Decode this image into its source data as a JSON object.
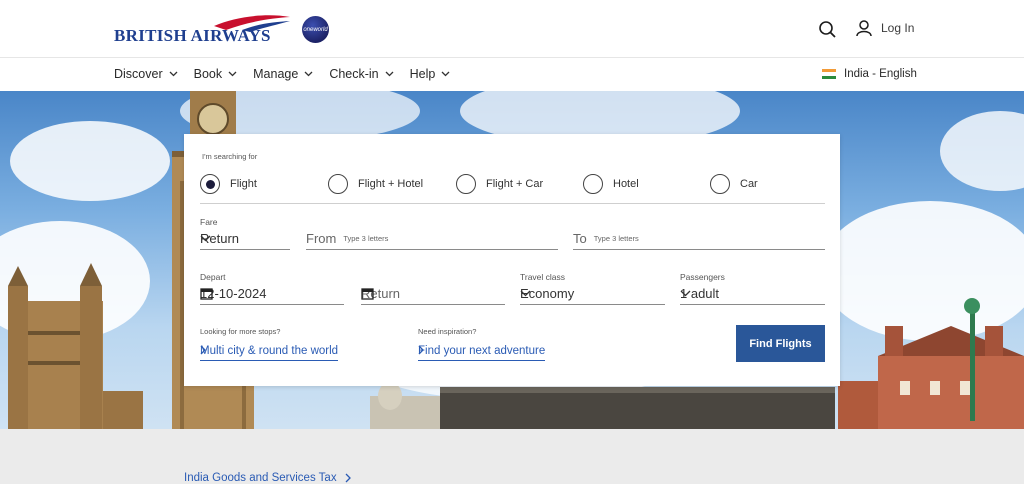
{
  "header": {
    "brand": "BRITISH AIRWAYS",
    "alliance": "oneworld",
    "login_label": "Log In"
  },
  "nav": {
    "items": [
      {
        "label": "Discover"
      },
      {
        "label": "Book"
      },
      {
        "label": "Manage"
      },
      {
        "label": "Check-in"
      },
      {
        "label": "Help"
      }
    ],
    "locale": "India - English"
  },
  "booking": {
    "searching_label": "I'm searching for",
    "options": [
      {
        "label": "Flight",
        "selected": true
      },
      {
        "label": "Flight + Hotel",
        "selected": false
      },
      {
        "label": "Flight + Car",
        "selected": false
      },
      {
        "label": "Hotel",
        "selected": false
      },
      {
        "label": "Car",
        "selected": false
      }
    ],
    "fare_label": "Fare",
    "fare_value": "Return",
    "from_label": "From",
    "from_hint": "Type 3 letters",
    "to_label": "To",
    "to_hint": "Type 3 letters",
    "depart_label": "Depart",
    "depart_value": "12-10-2024",
    "return_placeholder": "Return",
    "travel_class_label": "Travel class",
    "travel_class_value": "Economy",
    "passengers_label": "Passengers",
    "passengers_value": "1 adult",
    "more_stops_label": "Looking for more stops?",
    "multi_city_link": "Multi city & round the world",
    "inspiration_label": "Need inspiration?",
    "adventure_link": "Find your next adventure",
    "find_button": "Find Flights"
  },
  "footer": {
    "gst_link": "India Goods and Services Tax"
  },
  "colors": {
    "brand_blue": "#1f3f8f",
    "button_blue": "#2a5799",
    "link_blue": "#2a5bb4",
    "footer_bg": "#ebebeb"
  }
}
